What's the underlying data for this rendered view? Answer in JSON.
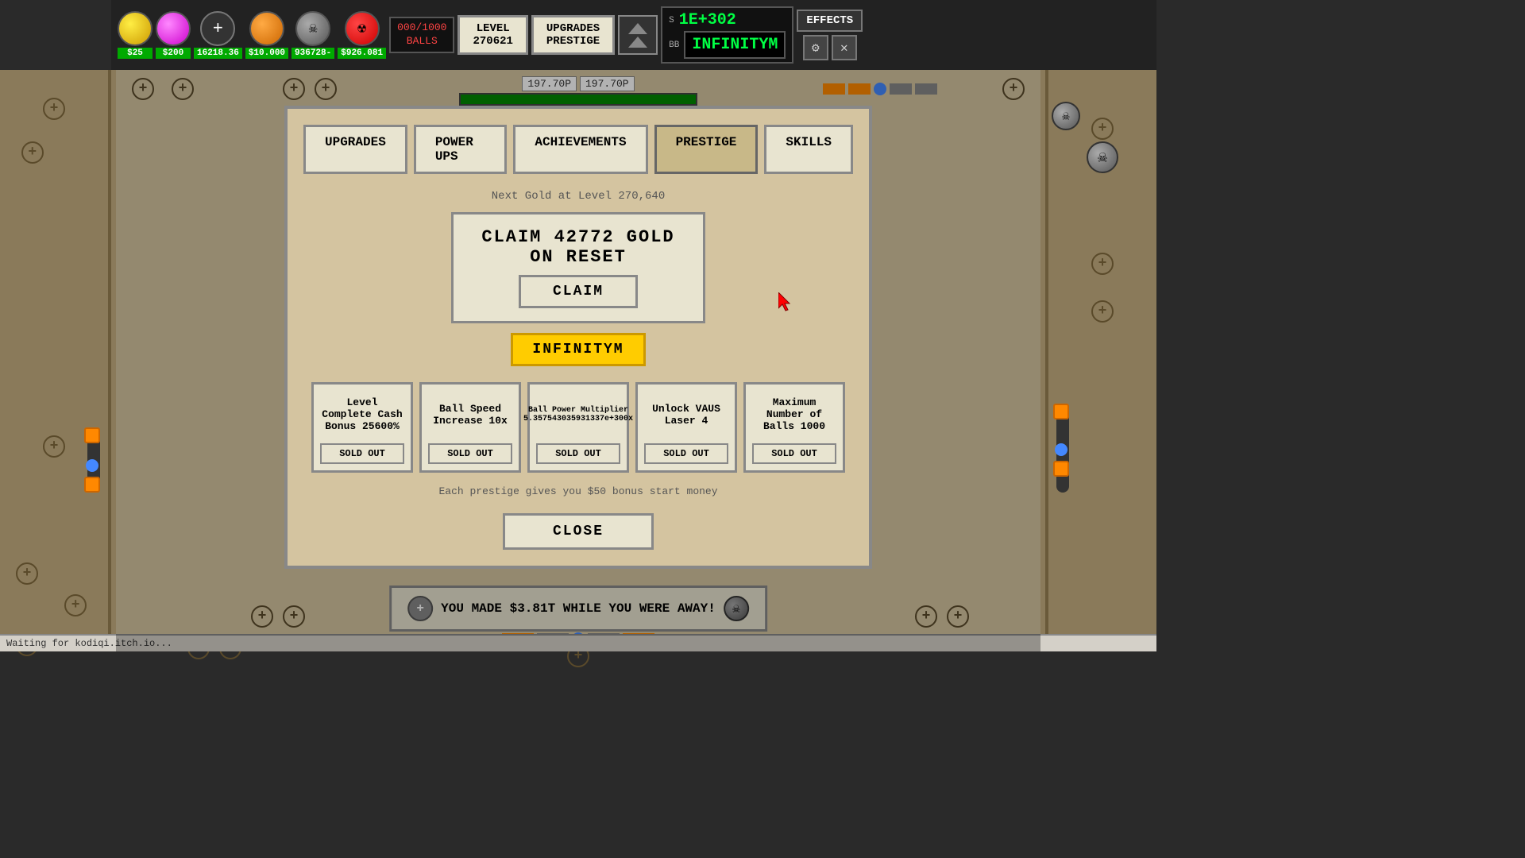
{
  "topbar": {
    "balls_counter": "000/1000\nBALLS",
    "balls_current": "000",
    "balls_max": "1000",
    "level_label": "LEVEL",
    "level_value": "270621",
    "upgrades_prestige_label": "UPGRADES\nPRESTIGE",
    "currency_s_label": "S",
    "currency_bb_label": "BB",
    "currency_value": "1E+302",
    "infinitym_label": "INFINITYM",
    "effects_label": "EFFECTS",
    "ball_prices": [
      "$25",
      "$200",
      "16218.36",
      "$10.000",
      "936728-",
      "$926.081"
    ]
  },
  "hud": {
    "health_val1": "197.70P",
    "health_val2": "197.70P"
  },
  "modal": {
    "tabs": [
      "UPGRADES",
      "POWER UPS",
      "ACHIEVEMENTS",
      "PRESTIGE",
      "SKILLS"
    ],
    "active_tab": "PRESTIGE",
    "next_gold_text": "Next Gold at Level 270,640",
    "claim_title": "CLAIM 42772 GOLD ON RESET",
    "claim_btn": "CLAIM",
    "infinitym_badge": "INFINITYM",
    "upgrades": [
      {
        "name": "Level Complete Cash Bonus 25600%",
        "sold_label": "SOLD OUT"
      },
      {
        "name": "Ball Speed Increase 10x",
        "sold_label": "SOLD OUT"
      },
      {
        "name": "Ball Power Multiplier 5.357543035931337e+300x",
        "sold_label": "SOLD OUT"
      },
      {
        "name": "Unlock VAUS Laser 4",
        "sold_label": "SOLD OUT"
      },
      {
        "name": "Maximum Number of Balls 1000",
        "sold_label": "SOLD OUT"
      }
    ],
    "bonus_text": "Each prestige gives you $50 bonus start money",
    "close_btn": "CLOSE"
  },
  "notification": {
    "text": "YOU MADE $3.81T WHILE YOU WERE AWAY!"
  },
  "statusbar": {
    "text": "Waiting for kodiqi.itch.io..."
  }
}
